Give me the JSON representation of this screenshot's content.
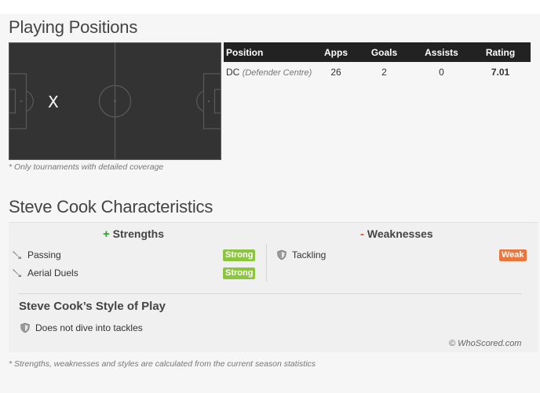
{
  "positions": {
    "title": "Playing Positions",
    "table": {
      "headers": [
        "Position",
        "Apps",
        "Goals",
        "Assists",
        "Rating"
      ],
      "rows": [
        {
          "position": "DC",
          "position_desc": "(Defender Centre)",
          "apps": "26",
          "goals": "2",
          "assists": "0",
          "rating": "7.01"
        }
      ]
    },
    "pitch_marker": "X",
    "footnote": "* Only tournaments with detailed coverage"
  },
  "characteristics": {
    "title": "Steve Cook Characteristics",
    "strengths_sign": "+",
    "strengths_label": "Strengths",
    "weaknesses_sign": "-",
    "weaknesses_label": "Weaknesses",
    "strengths": [
      {
        "label": "Passing",
        "level": "Strong",
        "icon": "boot-icon"
      },
      {
        "label": "Aerial Duels",
        "level": "Strong",
        "icon": "boot-icon"
      }
    ],
    "weaknesses": [
      {
        "label": "Tackling",
        "level": "Weak",
        "icon": "shield-icon"
      }
    ],
    "style_title": "Steve Cook’s Style of Play",
    "styles": [
      {
        "label": "Does not dive into tackles",
        "icon": "shield-icon"
      }
    ],
    "copyright": "© WhoScored.com",
    "footnote": "* Strengths, weaknesses and styles are calculated from the current season statistics"
  },
  "colors": {
    "strong": "#8cc63f",
    "weak": "#e9763d",
    "rating": "#f07f28",
    "pitch": "#333333"
  }
}
